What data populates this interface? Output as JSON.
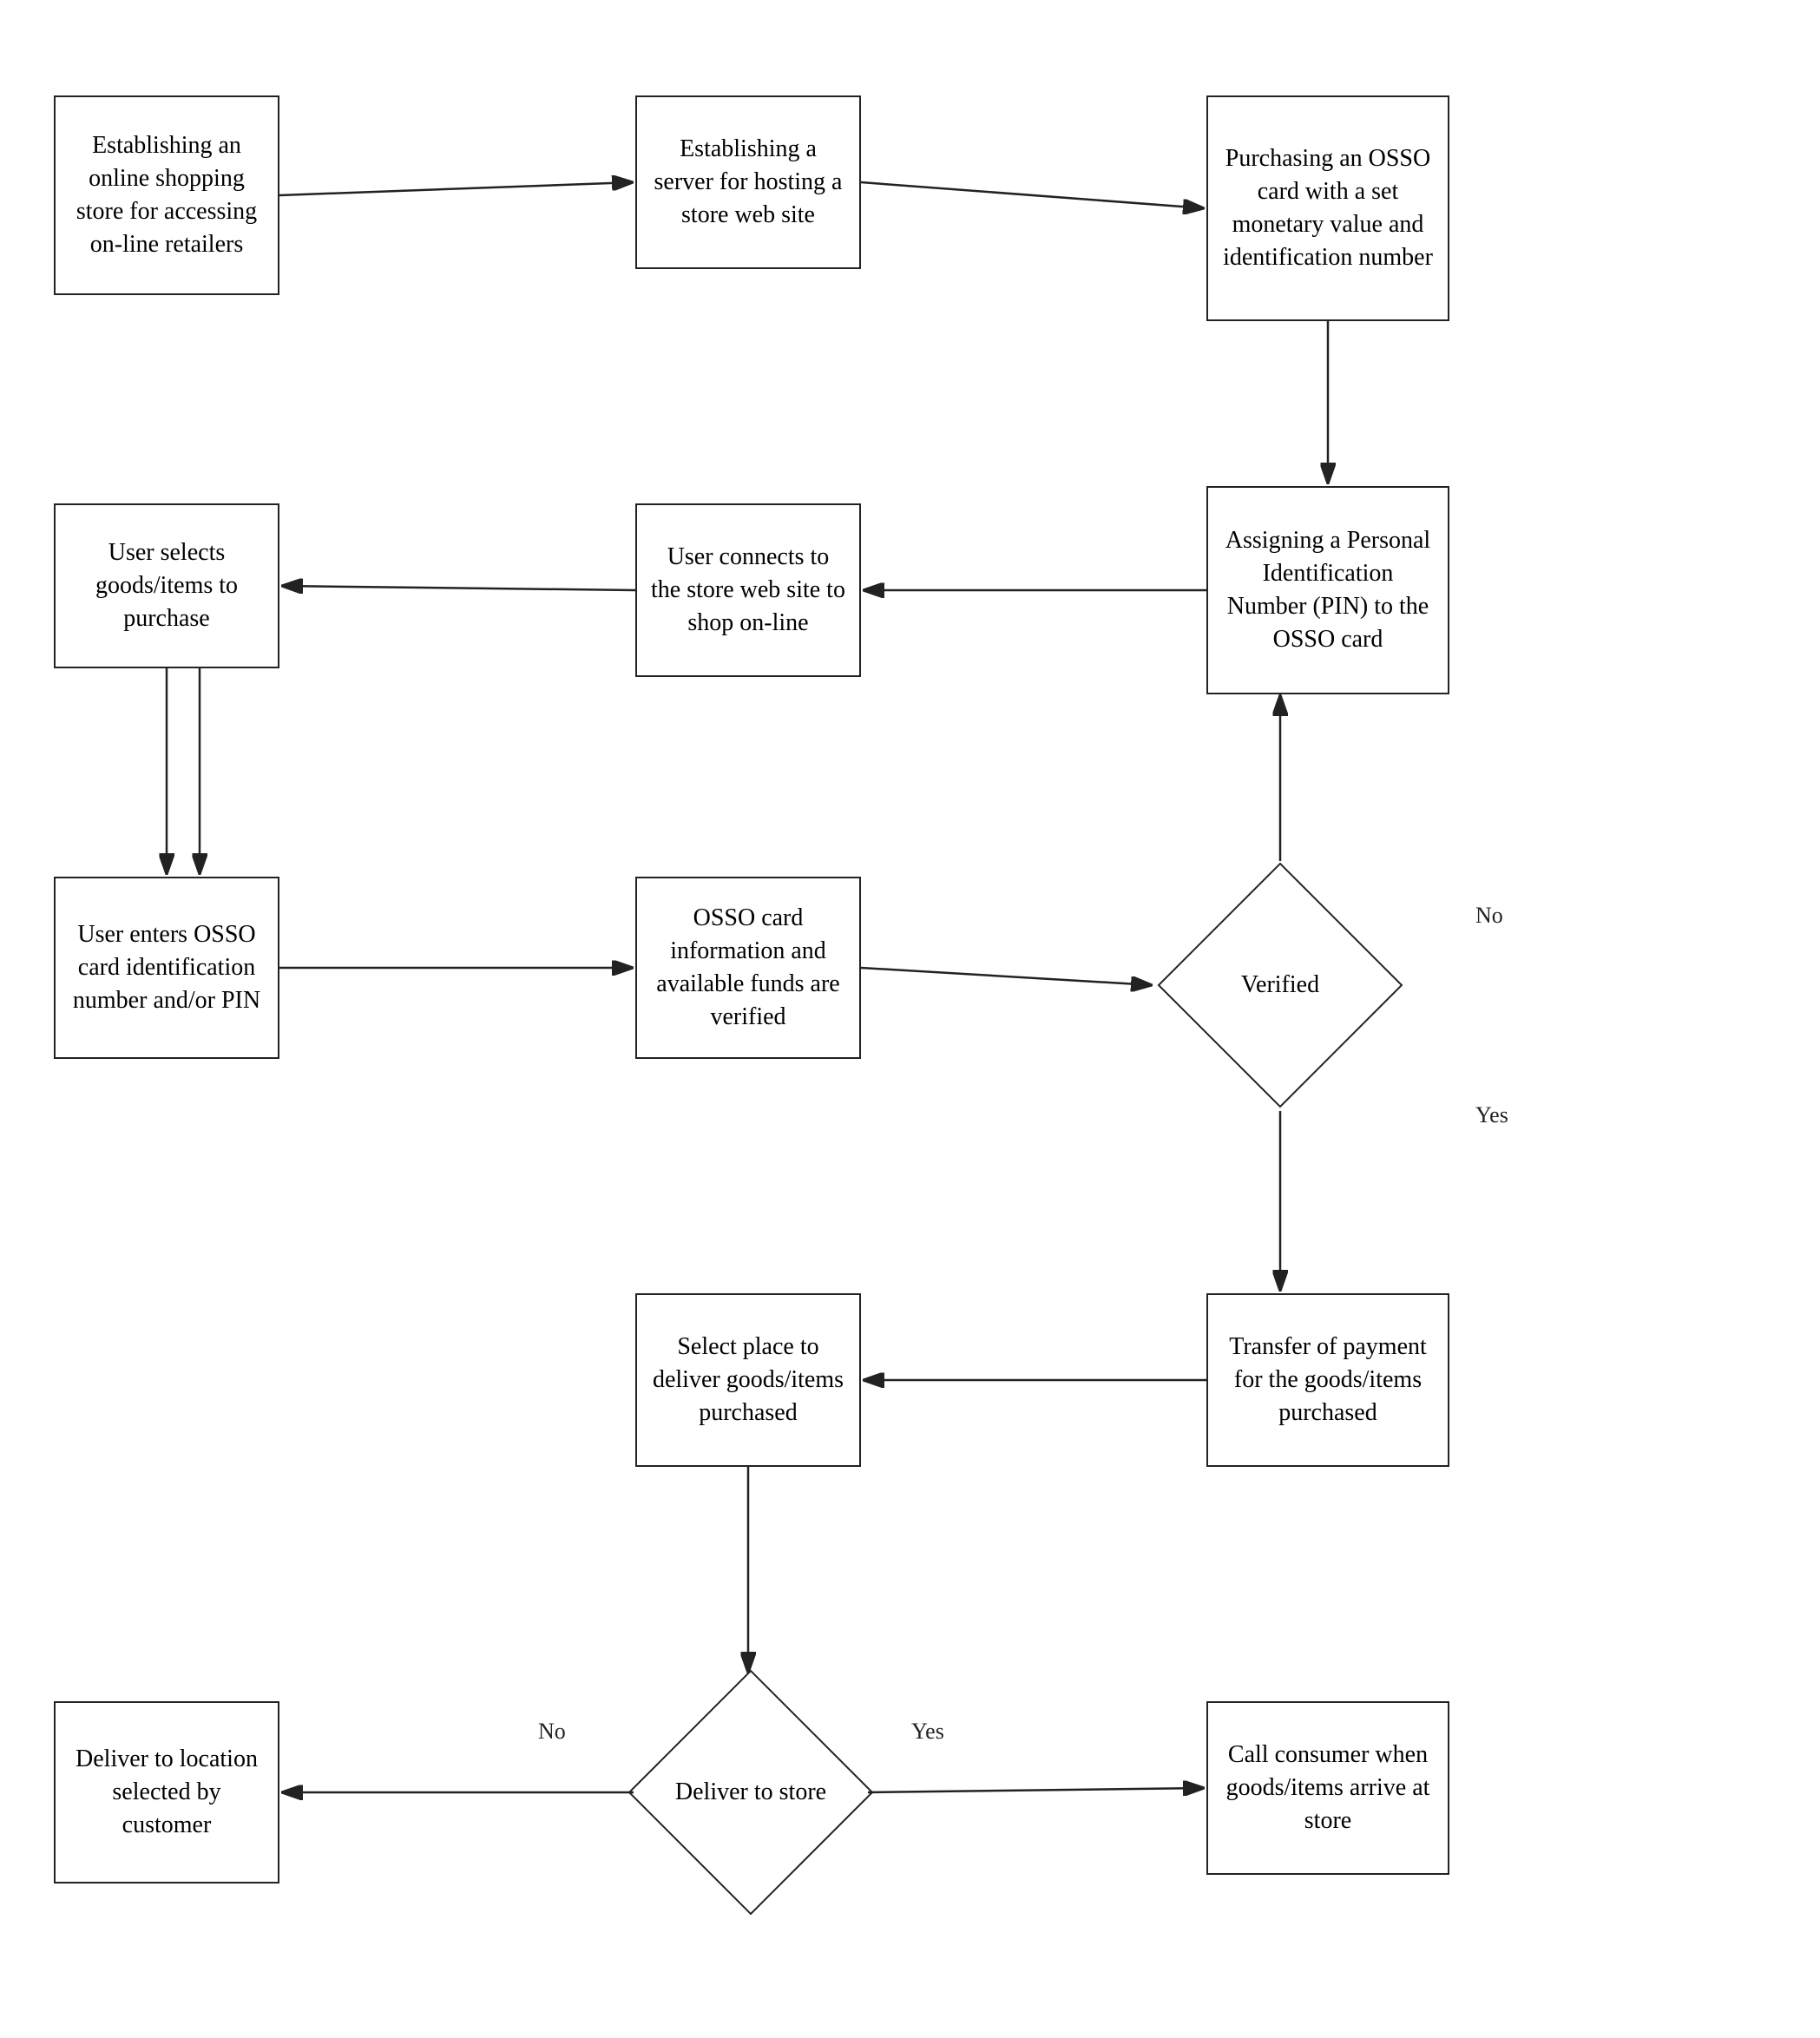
{
  "boxes": {
    "box1": {
      "label": "Establishing an online shopping store for accessing on-line retailers"
    },
    "box2": {
      "label": "Establishing a server for hosting a store web site"
    },
    "box3": {
      "label": "Purchasing an OSSO card with a set monetary value and identification number"
    },
    "box4": {
      "label": "Assigning a Personal Identification Number (PIN) to the OSSO card"
    },
    "box5": {
      "label": "User connects to the store web site to shop on-line"
    },
    "box6": {
      "label": "User selects goods/items to purchase"
    },
    "box7": {
      "label": "User enters OSSO card identification number and/or PIN"
    },
    "box8": {
      "label": "OSSO card information and available funds are verified"
    },
    "box9": {
      "label": "Transfer of payment for the goods/items purchased"
    },
    "box10": {
      "label": "Select place to deliver goods/items purchased"
    },
    "box11": {
      "label": "Deliver to location selected by customer"
    },
    "box12": {
      "label": "Call consumer when goods/items arrive at store"
    },
    "diamond1": {
      "label": "Verified"
    },
    "diamond2": {
      "label": "Deliver to store"
    }
  },
  "labels": {
    "no1": "No",
    "yes1": "Yes",
    "no2": "No",
    "yes2": "Yes"
  }
}
